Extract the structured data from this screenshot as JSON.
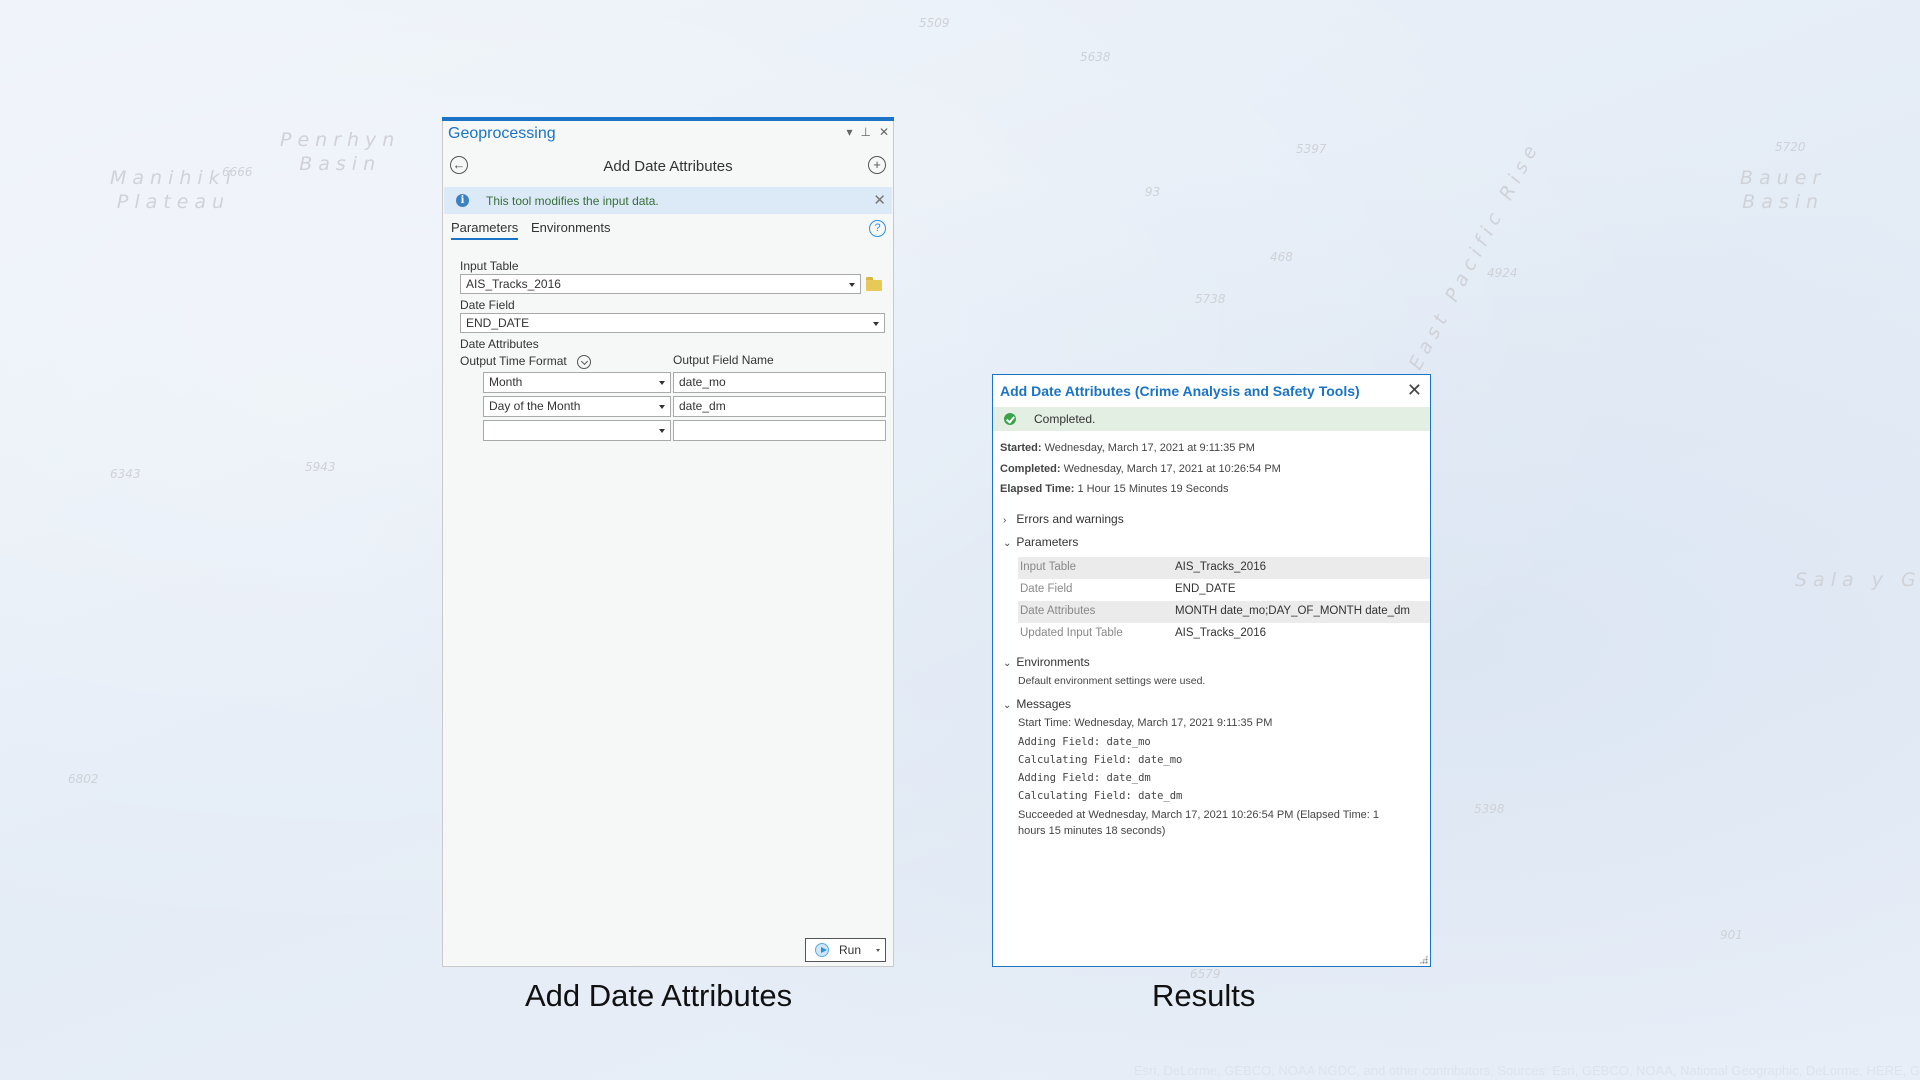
{
  "map": {
    "labels": [
      {
        "text": "Penrhyn\nBasin",
        "kind": "feature"
      },
      {
        "text": "Manihiki\nPlateau",
        "kind": "feature"
      },
      {
        "text": "Bauer\nBasin",
        "kind": "feature"
      },
      {
        "text": "Sala y Gón",
        "kind": "feature"
      },
      {
        "text": "East Pacific Rise",
        "kind": "feature"
      },
      {
        "text": "6666",
        "kind": "depth"
      },
      {
        "text": "5509",
        "kind": "depth"
      },
      {
        "text": "5638",
        "kind": "depth"
      },
      {
        "text": "5397",
        "kind": "depth"
      },
      {
        "text": "93",
        "kind": "depth"
      },
      {
        "text": "468",
        "kind": "depth"
      },
      {
        "text": "5738",
        "kind": "depth"
      },
      {
        "text": "4924",
        "kind": "depth"
      },
      {
        "text": "5720",
        "kind": "depth"
      },
      {
        "text": "6343",
        "kind": "depth"
      },
      {
        "text": "5943",
        "kind": "depth"
      },
      {
        "text": "6802",
        "kind": "depth"
      },
      {
        "text": "5398",
        "kind": "depth"
      },
      {
        "text": "901",
        "kind": "depth"
      },
      {
        "text": "6579",
        "kind": "depth"
      }
    ],
    "attribution": "Esri, DeLorme, GEBCO, NOAA NGDC, and other contributors, Sources: Esri, GEBCO, NOAA, National Geographic, DeLorme, HERE, G"
  },
  "geoprocessing": {
    "pane_title": "Geoprocessing",
    "controls": {
      "dropdown": "▾",
      "pin": "⊥",
      "close": "✕"
    },
    "tool_title": "Add Date Attributes",
    "info_message": "This tool modifies the input data.",
    "tabs": [
      {
        "label": "Parameters",
        "active": true
      },
      {
        "label": "Environments",
        "active": false
      }
    ],
    "params": {
      "input_table_label": "Input Table",
      "input_table_value": "AIS_Tracks_2016",
      "date_field_label": "Date Field",
      "date_field_value": "END_DATE",
      "date_attributes_label": "Date Attributes",
      "output_time_format_label": "Output Time Format",
      "output_field_name_label": "Output Field Name",
      "rows": [
        {
          "format": "Month",
          "field": "date_mo"
        },
        {
          "format": "Day of the Month",
          "field": "date_dm"
        },
        {
          "format": "",
          "field": ""
        }
      ]
    },
    "run_label": "Run"
  },
  "results": {
    "title": "Add Date Attributes (Crime Analysis and Safety Tools)",
    "status": "Completed.",
    "started_label": "Started:",
    "started_value": "Wednesday, March 17, 2021 at 9:11:35 PM",
    "completed_label": "Completed:",
    "completed_value": "Wednesday, March 17, 2021 at 10:26:54 PM",
    "elapsed_label": "Elapsed Time:",
    "elapsed_value": "1 Hour 15 Minutes 19 Seconds",
    "sections": {
      "errors": "Errors and warnings",
      "parameters": "Parameters",
      "environments": "Environments",
      "messages": "Messages"
    },
    "parameters": [
      {
        "name": "Input Table",
        "value": "AIS_Tracks_2016"
      },
      {
        "name": "Date Field",
        "value": "END_DATE"
      },
      {
        "name": "Date Attributes",
        "value": "MONTH date_mo;DAY_OF_MONTH date_dm"
      },
      {
        "name": "Updated Input Table",
        "value": "AIS_Tracks_2016"
      }
    ],
    "environments_text": "Default environment settings were used.",
    "messages": [
      {
        "text": "Start Time: Wednesday, March 17, 2021 9:11:35 PM",
        "mono": false
      },
      {
        "text": "Adding Field: date_mo",
        "mono": true
      },
      {
        "text": "Calculating Field: date_mo",
        "mono": true
      },
      {
        "text": "Adding Field: date_dm",
        "mono": true
      },
      {
        "text": "Calculating Field: date_dm",
        "mono": true
      },
      {
        "text": "Succeeded at Wednesday, March 17, 2021 10:26:54 PM (Elapsed Time: 1",
        "mono": false
      },
      {
        "text": "hours 15 minutes 18 seconds)",
        "mono": false
      }
    ]
  },
  "captions": {
    "left": "Add Date Attributes",
    "right": "Results"
  }
}
